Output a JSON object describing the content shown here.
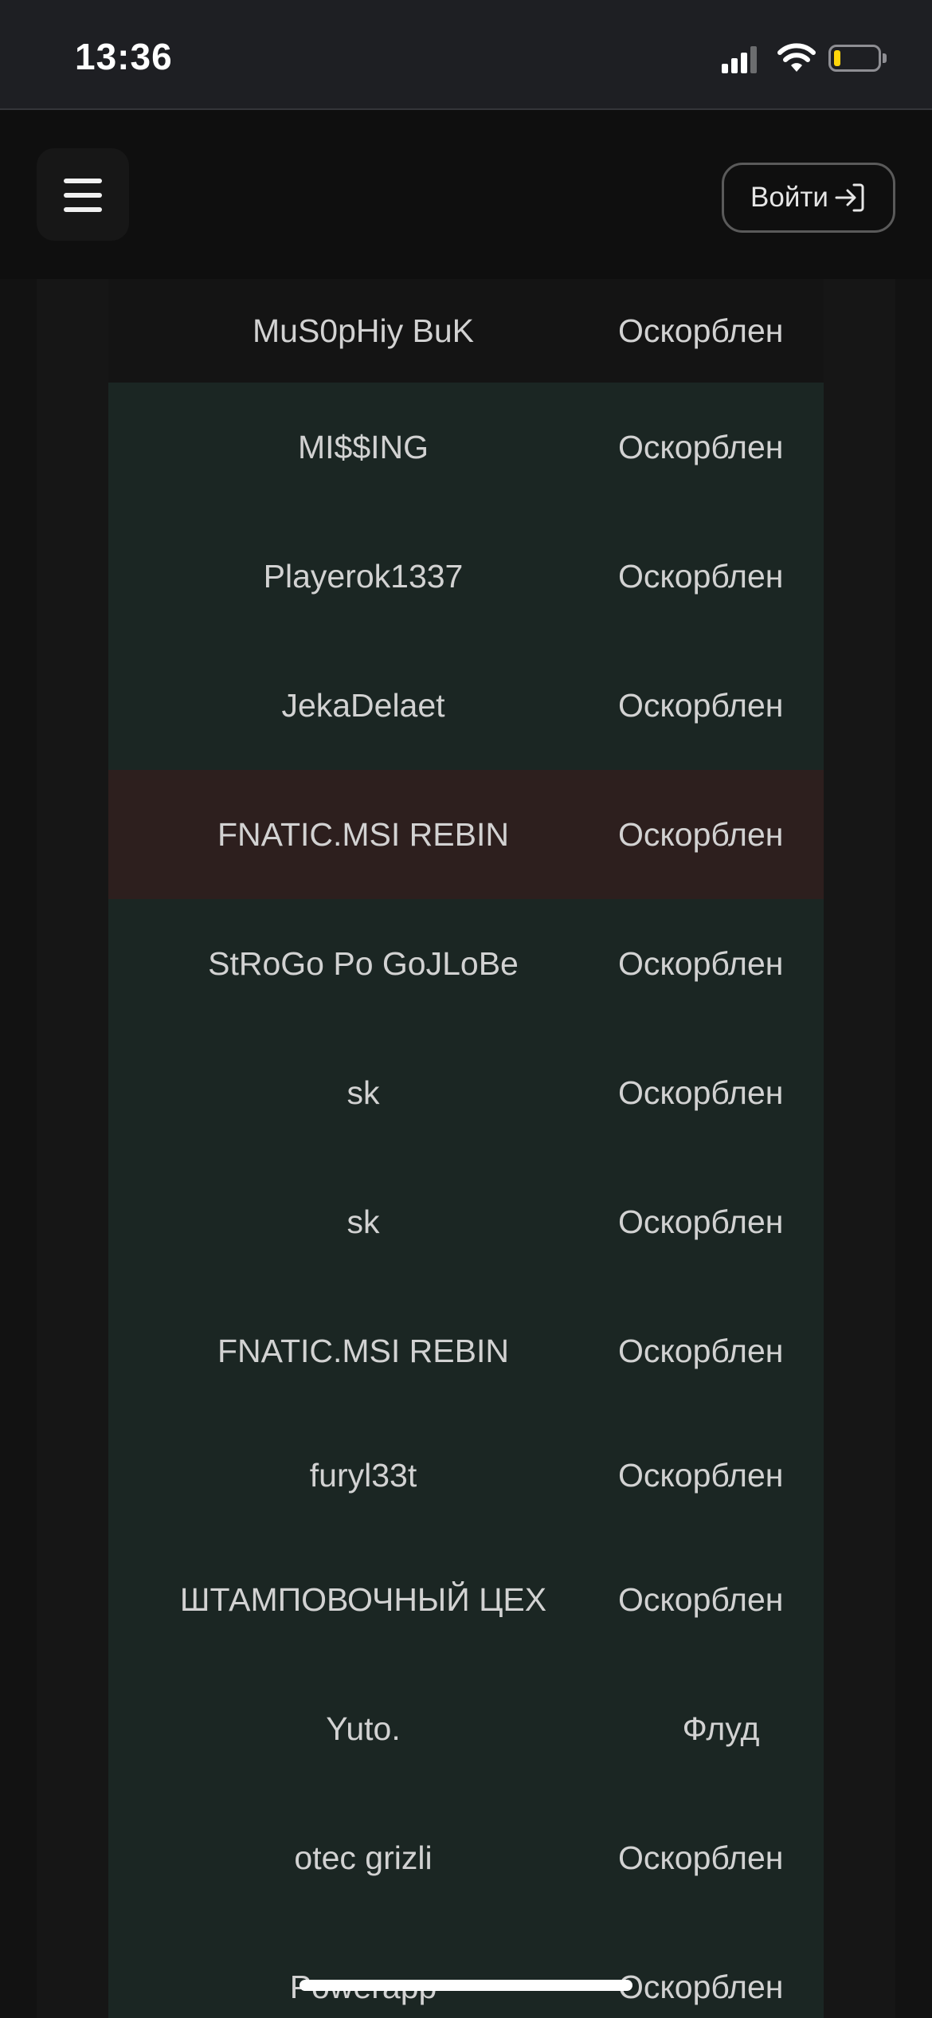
{
  "status_bar": {
    "time": "13:36",
    "battery_level": 0.15,
    "battery_color": "#ffd60a"
  },
  "header": {
    "menu_icon": "hamburger-menu-icon",
    "login_label": "Войти",
    "login_icon": "sign-in-icon"
  },
  "table": {
    "rows": [
      {
        "name": "MuS0pHiy BuK",
        "reason": "Оскорблен",
        "status": "plain"
      },
      {
        "name": "MI$$ING",
        "reason": "Оскорблен",
        "status": "green"
      },
      {
        "name": "Playerok1337",
        "reason": "Оскорблен",
        "status": "green"
      },
      {
        "name": "JekaDelaet",
        "reason": "Оскорблен",
        "status": "green"
      },
      {
        "name": "FNATIC.MSI REBIN",
        "reason": "Оскорблен",
        "status": "red"
      },
      {
        "name": "StRoGo Po GoJLoBe",
        "reason": "Оскорблен",
        "status": "green"
      },
      {
        "name": "sk",
        "reason": "Оскорблен",
        "status": "green"
      },
      {
        "name": "sk",
        "reason": "Оскорблен",
        "status": "green"
      },
      {
        "name": "FNATIC.MSI REBIN",
        "reason": "Оскорблен",
        "status": "green"
      },
      {
        "name": "furyl33t",
        "reason": "Оскорблен",
        "status": "green"
      },
      {
        "name": "ШТАМПОВОЧНЫЙ ЦЕХ",
        "reason": "Оскорблен",
        "status": "green"
      },
      {
        "name": "Yuto.",
        "reason": "Флуд",
        "status": "green"
      },
      {
        "name": "otec grizli",
        "reason": "Оскорблен",
        "status": "green"
      },
      {
        "name": "Powerapp",
        "reason": "Оскорблен",
        "status": "green"
      }
    ]
  },
  "colors": {
    "row_green": "#1b2623",
    "row_red": "#2d1f1e",
    "text": "#d2d2d2"
  }
}
